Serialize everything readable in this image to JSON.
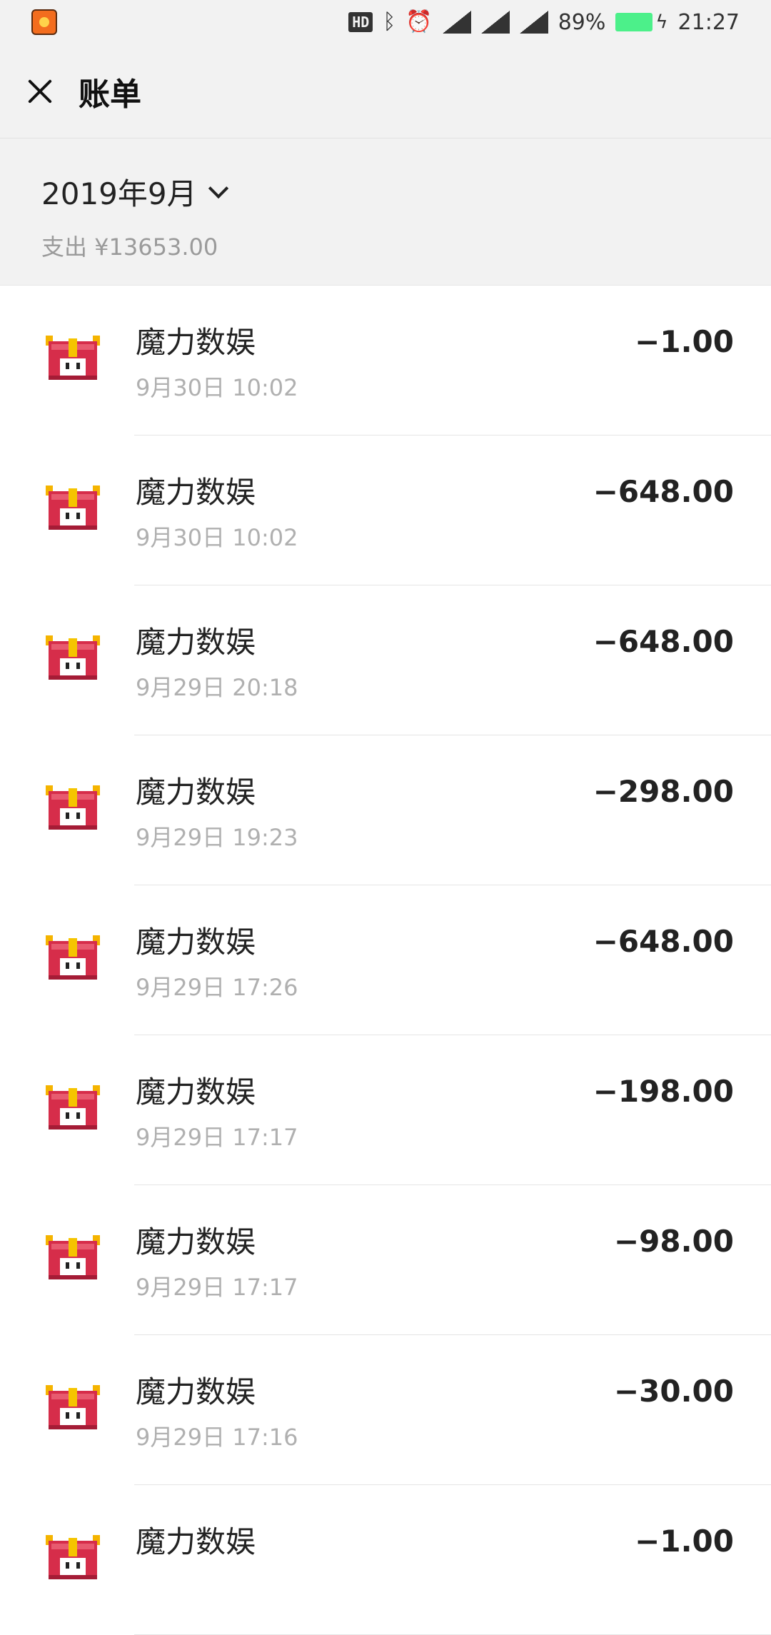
{
  "status_bar": {
    "app_icon": "game-app-icon",
    "hd_label": "HD",
    "battery_text": "89%",
    "time": "21:27",
    "battery_color": "#4cf08a"
  },
  "header": {
    "title": "账单",
    "close_icon": "close-icon"
  },
  "summary": {
    "month": "2019年9月",
    "spend": "支出 ¥13653.00"
  },
  "transactions": [
    {
      "merchant": "魔力数娱",
      "datetime": "9月30日 10:02",
      "amount": "−1.00"
    },
    {
      "merchant": "魔力数娱",
      "datetime": "9月30日 10:02",
      "amount": "−648.00"
    },
    {
      "merchant": "魔力数娱",
      "datetime": "9月29日 20:18",
      "amount": "−648.00"
    },
    {
      "merchant": "魔力数娱",
      "datetime": "9月29日 19:23",
      "amount": "−298.00"
    },
    {
      "merchant": "魔力数娱",
      "datetime": "9月29日 17:26",
      "amount": "−648.00"
    },
    {
      "merchant": "魔力数娱",
      "datetime": "9月29日 17:17",
      "amount": "−198.00"
    },
    {
      "merchant": "魔力数娱",
      "datetime": "9月29日 17:17",
      "amount": "−98.00"
    },
    {
      "merchant": "魔力数娱",
      "datetime": "9月29日 17:16",
      "amount": "−30.00"
    },
    {
      "merchant": "魔力数娱",
      "datetime": "",
      "amount": "−1.00"
    }
  ]
}
